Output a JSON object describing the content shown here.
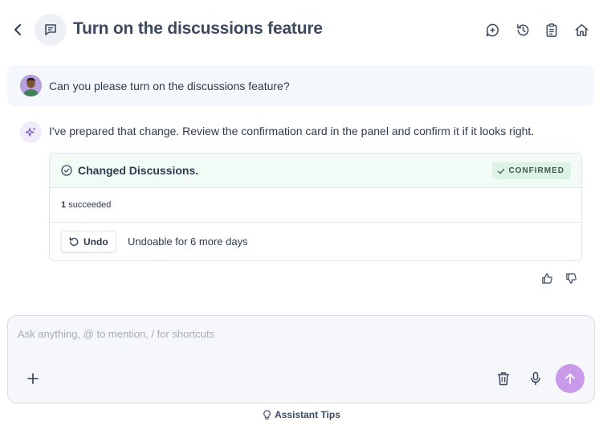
{
  "header": {
    "title": "Turn on the discussions feature"
  },
  "user_message": {
    "text": "Can you please turn on the discussions feature?"
  },
  "assistant_message": {
    "text": "I've prepared that change. Review the confirmation card in the panel and confirm it if it looks right."
  },
  "card": {
    "title": "Changed Discussions.",
    "status": "CONFIRMED",
    "count": "1",
    "count_label": "succeeded",
    "undo_label": "Undo",
    "undo_note": "Undoable for 6 more days"
  },
  "composer": {
    "placeholder": "Ask anything, @ to mention, / for shortcuts"
  },
  "footer": {
    "tips_label": "Assistant Tips"
  },
  "colors": {
    "accent": "#c99ae9",
    "success_bg": "#f2fbf6",
    "badge_bg": "#dcf2e6"
  }
}
